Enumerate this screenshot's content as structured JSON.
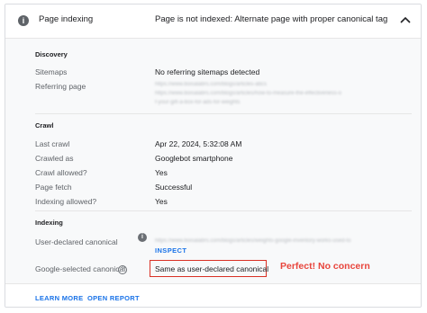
{
  "header": {
    "title": "Page indexing",
    "status": "Page is not indexed: Alternate page with proper canonical tag"
  },
  "discovery": {
    "section_title": "Discovery",
    "sitemaps_label": "Sitemaps",
    "sitemaps_value": "No referring sitemaps detected",
    "referring_label": "Referring page",
    "referring_blurred_lines": [
      "https://www.boisalabrs.com/blogs/articles-abcs",
      "https://www.boisalabrs.com/blogs/articles/how-to-measure-the-effectiveness-o",
      "f-your-gift-a-box-for-ads-for-weights"
    ]
  },
  "crawl": {
    "section_title": "Crawl",
    "last_crawl_label": "Last crawl",
    "last_crawl_value": "Apr 22, 2024, 5:32:08 AM",
    "crawled_as_label": "Crawled as",
    "crawled_as_value": "Googlebot smartphone",
    "crawl_allowed_label": "Crawl allowed?",
    "crawl_allowed_value": "Yes",
    "page_fetch_label": "Page fetch",
    "page_fetch_value": "Successful",
    "indexing_allowed_label": "Indexing allowed?",
    "indexing_allowed_value": "Yes"
  },
  "indexing": {
    "section_title": "Indexing",
    "user_canonical_label": "User-declared canonical",
    "user_canonical_blurred": "https://www.boisalabrs.com/blogs/articles/weights-google-inventory-works-used-to",
    "inspect_label": "INSPECT",
    "google_canonical_label": "Google-selected canonical",
    "google_canonical_value": "Same as user-declared canonical"
  },
  "annotation": "Perfect! No concern",
  "footer": {
    "learn_more": "LEARN MORE",
    "open_report": "OPEN REPORT"
  },
  "colors": {
    "accent": "#1a73e8",
    "annotation_red": "#e8453c",
    "highlight_border": "#d93025"
  },
  "icons": [
    "info-icon",
    "chevron-up-icon",
    "help-icon"
  ]
}
